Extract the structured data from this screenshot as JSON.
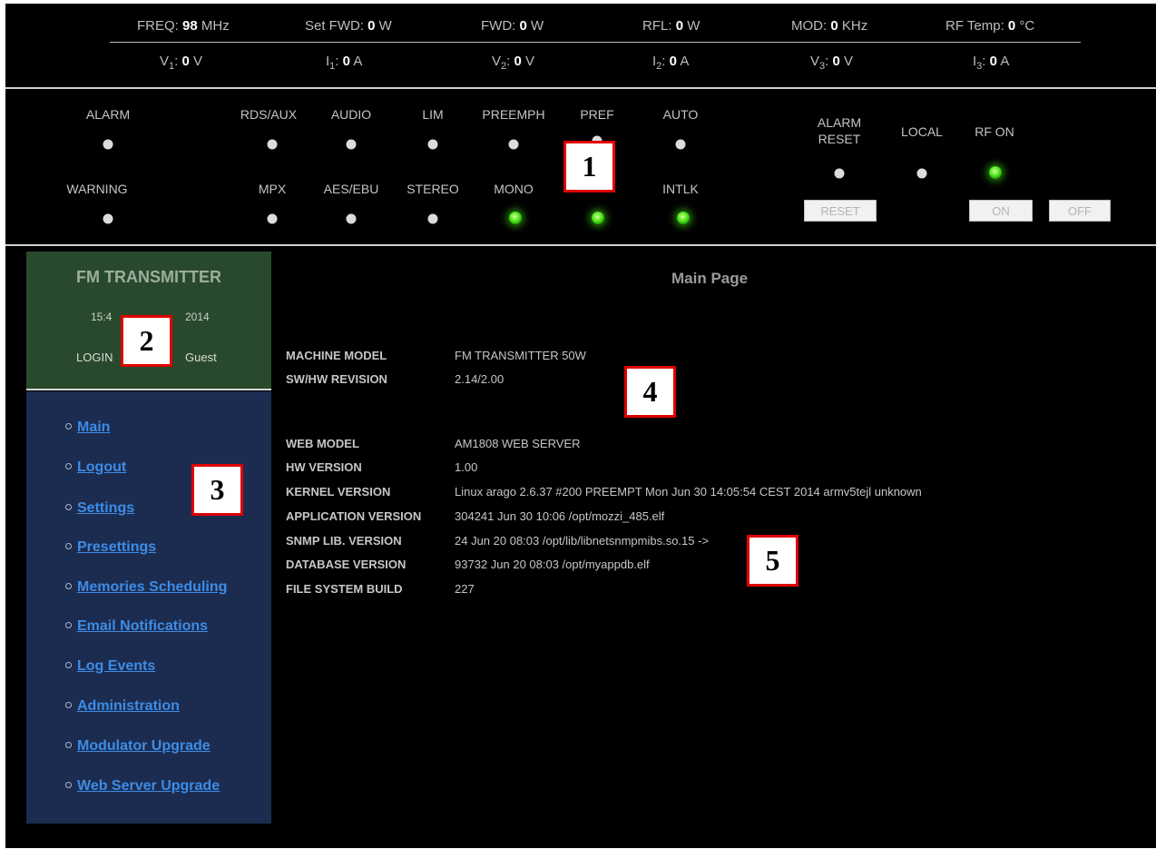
{
  "measurements": {
    "freq": {
      "label": "FREQ: ",
      "value": "98",
      "unit": " MHz"
    },
    "set_fwd": {
      "label": "Set FWD: ",
      "value": "0",
      "unit": " W"
    },
    "fwd": {
      "label": "FWD: ",
      "value": "0",
      "unit": " W"
    },
    "rfl": {
      "label": "RFL: ",
      "value": "0",
      "unit": " W"
    },
    "mod": {
      "label": "MOD: ",
      "value": "0",
      "unit": " KHz"
    },
    "rf_temp": {
      "label": "RF Temp: ",
      "value": "0",
      "unit": " °C"
    },
    "v1": {
      "label": "V",
      "sub": "1",
      "sep": ": ",
      "value": "0",
      "unit": " V"
    },
    "i1": {
      "label": "I",
      "sub": "1",
      "sep": ": ",
      "value": "0",
      "unit": " A"
    },
    "v2": {
      "label": "V",
      "sub": "2",
      "sep": ": ",
      "value": "0",
      "unit": " V"
    },
    "i2": {
      "label": "I",
      "sub": "2",
      "sep": ": ",
      "value": "0",
      "unit": " A"
    },
    "v3": {
      "label": "V",
      "sub": "3",
      "sep": ": ",
      "value": "0",
      "unit": " V"
    },
    "i3": {
      "label": "I",
      "sub": "3",
      "sep": ": ",
      "value": "0",
      "unit": " A"
    }
  },
  "indicators": {
    "alarm": {
      "label": "ALARM",
      "state": "off"
    },
    "rds_aux": {
      "label": "RDS/AUX",
      "state": "off"
    },
    "audio": {
      "label": "AUDIO",
      "state": "off"
    },
    "lim": {
      "label": "LIM",
      "state": "off"
    },
    "preemph": {
      "label": "PREEMPH",
      "state": "off"
    },
    "pref": {
      "label": "PREF",
      "state": "off"
    },
    "auto": {
      "label": "AUTO",
      "state": "off"
    },
    "warning": {
      "label": "WARNING",
      "state": "off"
    },
    "mpx": {
      "label": "MPX",
      "state": "off"
    },
    "aes_ebu": {
      "label": "AES/EBU",
      "state": "off"
    },
    "stereo": {
      "label": "STEREO",
      "state": "off"
    },
    "mono": {
      "label": "MONO",
      "state": "on"
    },
    "pref_2": {
      "label": "",
      "state": "on"
    },
    "intlk": {
      "label": "INTLK",
      "state": "on"
    }
  },
  "controls": {
    "alarm_reset": {
      "label_line1": "ALARM",
      "label_line2": "RESET",
      "state": "off",
      "button": "RESET"
    },
    "local": {
      "label": "LOCAL",
      "state": "off"
    },
    "rf_on": {
      "label": "RF ON",
      "state": "on",
      "on_button": "ON",
      "off_button": "OFF"
    }
  },
  "sidebar": {
    "app_title": "FM TRANSMITTER",
    "time_prefix": "15:4",
    "time_suffix": "2014",
    "login_prefix": "LOGIN",
    "login_user": "Guest",
    "nav_items": [
      {
        "label": "Main"
      },
      {
        "label": "Logout"
      },
      {
        "label": "Settings"
      },
      {
        "label": "Presettings"
      },
      {
        "label": "Memories Scheduling"
      },
      {
        "label": "Email Notifications"
      },
      {
        "label": "Log Events"
      },
      {
        "label": "Administration"
      },
      {
        "label": "Modulator Upgrade"
      },
      {
        "label": "Web Server Upgrade"
      }
    ]
  },
  "main": {
    "title": "Main Page",
    "machine_info": [
      {
        "label": "MACHINE MODEL",
        "value": "FM TRANSMITTER 50W"
      },
      {
        "label": "SW/HW REVISION",
        "value": "2.14/2.00"
      }
    ],
    "web_info": [
      {
        "label": "WEB MODEL",
        "value": "AM1808 WEB SERVER"
      },
      {
        "label": "HW VERSION",
        "value": "1.00"
      },
      {
        "label": "KERNEL VERSION",
        "value": "Linux arago 2.6.37 #200 PREEMPT Mon Jun 30 14:05:54 CEST 2014 armv5tejl unknown"
      },
      {
        "label": "APPLICATION VERSION",
        "value": "304241 Jun 30 10:06 /opt/mozzi_485.elf"
      },
      {
        "label": "SNMP LIB. VERSION",
        "value": "24 Jun 20 08:03 /opt/lib/libnetsnmpmibs.so.15 ->"
      },
      {
        "label": "DATABASE VERSION",
        "value": "93732 Jun 20 08:03 /opt/myappdb.elf"
      },
      {
        "label": "FILE SYSTEM BUILD",
        "value": "227"
      }
    ]
  },
  "callouts": [
    "1",
    "2",
    "3",
    "4",
    "5"
  ],
  "colors": {
    "background": "#000000",
    "sidebar_header": "#29492c",
    "sidebar_nav": "#1c2c50",
    "link": "#3d8ce6",
    "led_on": "#4fe31a",
    "callout_border": "#e00000"
  }
}
